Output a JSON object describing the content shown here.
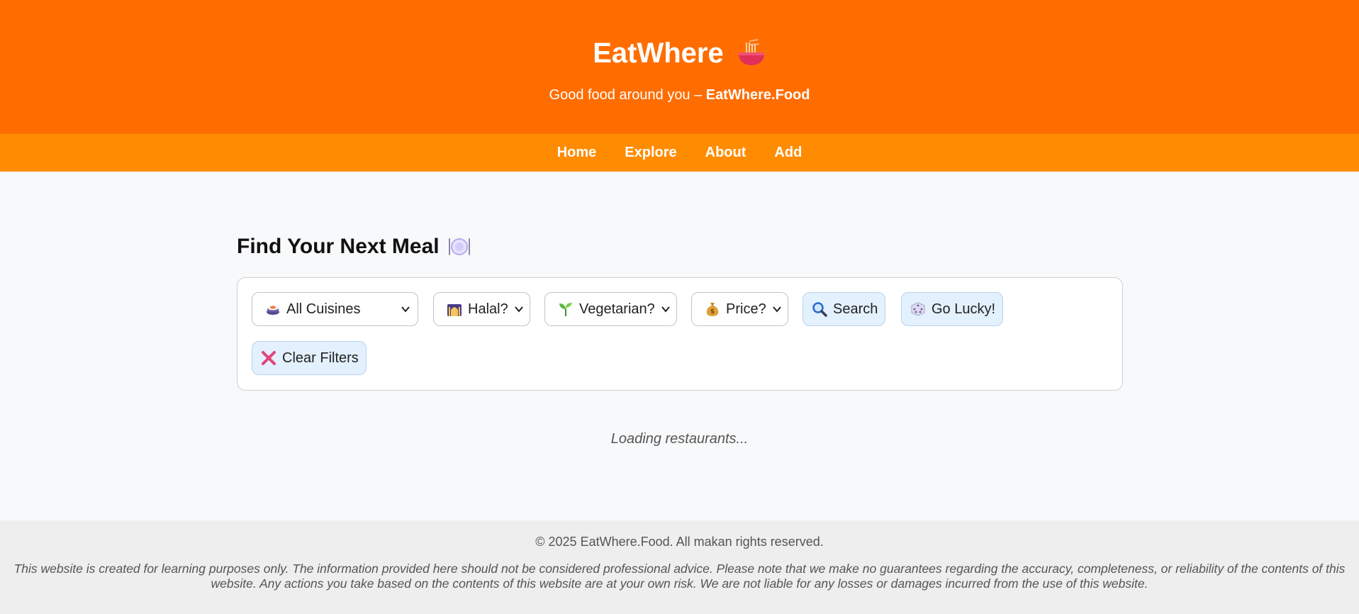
{
  "header": {
    "title": "EatWhere",
    "title_icon": "noodle-bowl-icon",
    "tagline_prefix": "Good food around you – ",
    "tagline_brand": "EatWhere.Food"
  },
  "nav": {
    "items": [
      {
        "label": "Home"
      },
      {
        "label": "Explore"
      },
      {
        "label": "About"
      },
      {
        "label": "Add"
      }
    ]
  },
  "main": {
    "title": "Find Your Next Meal",
    "title_icon": "plate-icon",
    "filters": {
      "cuisine": {
        "selected": "All Cuisines",
        "icon": "sushi-icon"
      },
      "halal": {
        "selected": "Halal?",
        "icon": "mosque-icon"
      },
      "vegetarian": {
        "selected": "Vegetarian?",
        "icon": "seedling-icon"
      },
      "price": {
        "selected": "Price?",
        "icon": "money-bag-icon"
      }
    },
    "buttons": {
      "search": {
        "label": "Search",
        "icon": "magnifier-icon"
      },
      "lucky": {
        "label": "Go Lucky!",
        "icon": "dice-icon"
      },
      "clear": {
        "label": "Clear Filters",
        "icon": "cross-mark-icon"
      }
    },
    "status": "Loading restaurants..."
  },
  "footer": {
    "copyright": "© 2025 EatWhere.Food. All makan rights reserved.",
    "disclaimer": "This website is created for learning purposes only. The information provided here should not be considered professional advice. Please note that we make no guarantees regarding the accuracy, completeness, or reliability of the contents of this website. Any actions you take based on the contents of this website are at your own risk. We are not liable for any losses or damages incurred from the use of this website."
  },
  "colors": {
    "header_bg": "#ff6d00",
    "nav_bg": "#ff8c00",
    "button_bg": "#e3f0fd",
    "page_bg": "#f8f9fa",
    "footer_bg": "#eeeeee"
  }
}
